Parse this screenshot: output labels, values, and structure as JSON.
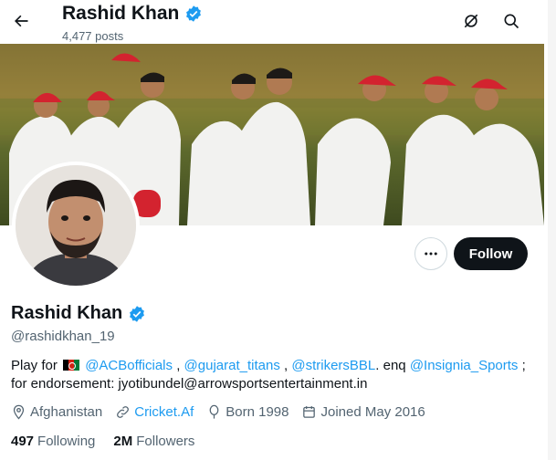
{
  "header": {
    "title": "Rashid Khan",
    "post_count": "4,477 posts"
  },
  "profile": {
    "name": "Rashid Khan",
    "handle": "@rashidkhan_19",
    "follow_label": "Follow",
    "bio": {
      "prefix": "Play for",
      "mention_1": "@ACBofficials",
      "sep_1": " , ",
      "mention_2": "@gujarat_titans",
      "sep_2": " ,  ",
      "mention_3": "@strikersBBL",
      "mid": ". enq ",
      "mention_4": "@Insignia_Sports",
      "suffix": " ; for endorsement: jyotibundel@arrowsportsentertainment.in"
    },
    "meta": {
      "location": "Afghanistan",
      "website": "Cricket.Af",
      "born": "Born 1998",
      "joined": "Joined May 2016"
    },
    "stats": {
      "following_count": "497",
      "following_label": "Following",
      "followers_count": "2M",
      "followers_label": "Followers"
    }
  },
  "colors": {
    "accent": "#1d9bf0",
    "text": "#0f1419",
    "muted": "#536471",
    "button": "#0f1419"
  },
  "icons": {
    "back": "arrow-left-icon",
    "grok": "grok-icon",
    "search": "search-icon",
    "verified": "verified-badge-icon",
    "more": "more-horizontal-icon",
    "location": "location-pin-icon",
    "link": "link-icon",
    "born": "balloon-icon",
    "joined": "calendar-icon"
  }
}
